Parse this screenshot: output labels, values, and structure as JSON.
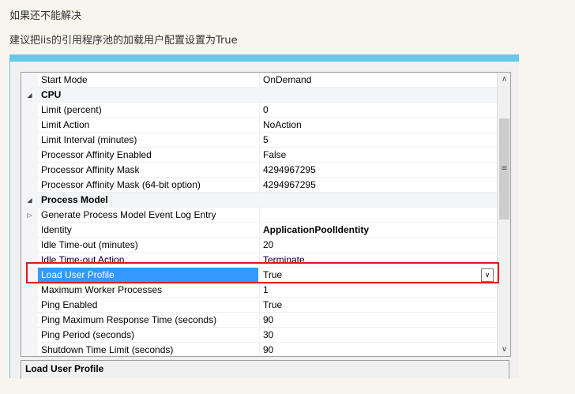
{
  "text": {
    "line1": "如果还不能解决",
    "line2": "建议把iis的引用程序池的加载用户配置设置为True"
  },
  "rows": [
    {
      "type": "prop",
      "label": "Start Mode",
      "value": "OnDemand"
    },
    {
      "type": "cat",
      "label": "CPU"
    },
    {
      "type": "prop",
      "label": "Limit (percent)",
      "value": "0"
    },
    {
      "type": "prop",
      "label": "Limit Action",
      "value": "NoAction"
    },
    {
      "type": "prop",
      "label": "Limit Interval (minutes)",
      "value": "5"
    },
    {
      "type": "prop",
      "label": "Processor Affinity Enabled",
      "value": "False"
    },
    {
      "type": "prop",
      "label": "Processor Affinity Mask",
      "value": "4294967295"
    },
    {
      "type": "prop",
      "label": "Processor Affinity Mask (64-bit option)",
      "value": "4294967295"
    },
    {
      "type": "cat",
      "label": "Process Model"
    },
    {
      "type": "expand",
      "label": "Generate Process Model Event Log Entry",
      "value": ""
    },
    {
      "type": "prop",
      "label": "Identity",
      "value": "ApplicationPoolIdentity",
      "bold": true
    },
    {
      "type": "prop",
      "label": "Idle Time-out (minutes)",
      "value": "20"
    },
    {
      "type": "prop",
      "label": "Idle Time-out Action",
      "value": "Terminate"
    },
    {
      "type": "sel",
      "label": "Load User Profile",
      "value": "True"
    },
    {
      "type": "prop",
      "label": "Maximum Worker Processes",
      "value": "1"
    },
    {
      "type": "prop",
      "label": "Ping Enabled",
      "value": "True"
    },
    {
      "type": "prop",
      "label": "Ping Maximum Response Time (seconds)",
      "value": "90"
    },
    {
      "type": "prop",
      "label": "Ping Period (seconds)",
      "value": "30"
    },
    {
      "type": "prop",
      "label": "Shutdown Time Limit (seconds)",
      "value": "90"
    }
  ],
  "description": {
    "title": "Load User Profile"
  }
}
